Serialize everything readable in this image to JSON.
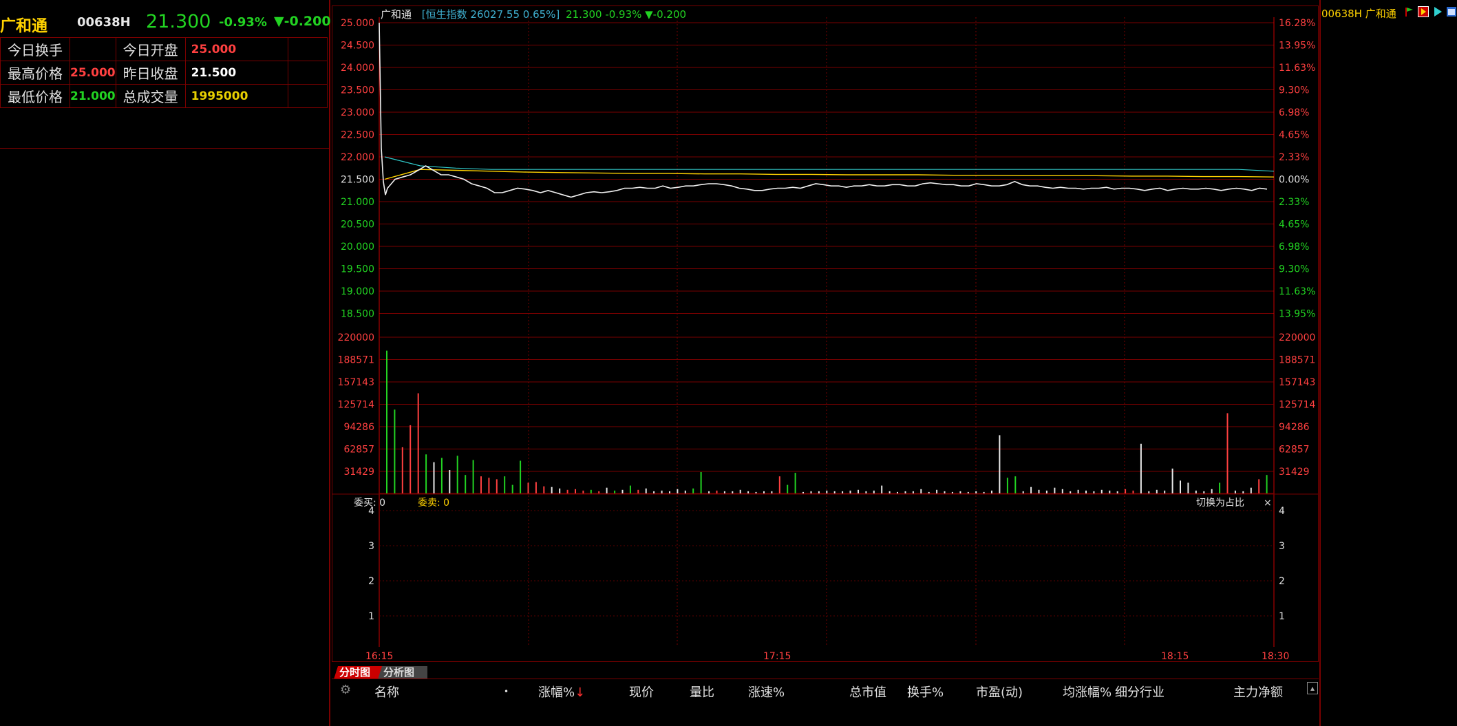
{
  "stock": {
    "name": "广和通",
    "code": "00638H",
    "price": "21.300",
    "change_pct": "-0.93%",
    "change": "▼-0.200",
    "rise_color": "#ff4040",
    "fall_color": "#22d322"
  },
  "info_table": {
    "row1": {
      "l1": "今日换手",
      "v1": "",
      "l2": "今日开盘",
      "v2": "25.000"
    },
    "row2": {
      "l1": "最高价格",
      "v1": "25.000",
      "l2": "昨日收盘",
      "v2": "21.500"
    },
    "row3": {
      "l1": "最低价格",
      "v1": "21.000",
      "l2": "总成交量",
      "v2": "1995000"
    }
  },
  "chart_header": {
    "name": "广和通",
    "index": "恒生指数 26027.55 0.65%",
    "price_info": "21.300 -0.93% ▼-0.200"
  },
  "chart_data": {
    "type": "line",
    "price_axis": {
      "left_ticks": [
        "25.000",
        "24.500",
        "24.000",
        "23.500",
        "23.000",
        "22.500",
        "22.000",
        "21.500",
        "21.000",
        "20.500",
        "20.000",
        "19.500",
        "19.000",
        "18.500"
      ],
      "right_ticks": [
        "16.28%",
        "13.95%",
        "11.63%",
        "9.30%",
        "6.98%",
        "4.65%",
        "2.33%",
        "0.00%",
        "2.33%",
        "4.65%",
        "6.98%",
        "9.30%",
        "11.63%",
        "13.95%"
      ],
      "ylim": [
        18.25,
        25.0
      ],
      "prev_close": 21.5
    },
    "volume_axis": {
      "ticks": [
        "220000",
        "188571",
        "157143",
        "125714",
        "94286",
        "62857",
        "31429"
      ],
      "ylim": [
        0,
        220000
      ]
    },
    "order_axis": {
      "ticks": [
        "4",
        "3",
        "2",
        "1"
      ]
    },
    "time_labels": [
      "16:15",
      "17:15",
      "18:15",
      "18:30"
    ],
    "series": [
      {
        "values": [
          25.0,
          22.2,
          21.45,
          21.15,
          21.3,
          21.5,
          21.55,
          21.6,
          21.7,
          21.8,
          21.7,
          21.6,
          21.6,
          21.55,
          21.5,
          21.4,
          21.35,
          21.3,
          21.2,
          21.2,
          21.25,
          21.3,
          21.28,
          21.25,
          21.2,
          21.25,
          21.2,
          21.15,
          21.1,
          21.15,
          21.2,
          21.22,
          21.2,
          21.22,
          21.25,
          21.3,
          21.3,
          21.32,
          21.3,
          21.3,
          21.35,
          21.3,
          21.32,
          21.35,
          21.35,
          21.38,
          21.4,
          21.4,
          21.38,
          21.35,
          21.3,
          21.28,
          21.25,
          21.25,
          21.28,
          21.3,
          21.3,
          21.32,
          21.3,
          21.35,
          21.4,
          21.38,
          21.35,
          21.35,
          21.32,
          21.35,
          21.35,
          21.38,
          21.35,
          21.35,
          21.38,
          21.38,
          21.35,
          21.35,
          21.4,
          21.42,
          21.4,
          21.38,
          21.38,
          21.35,
          21.35,
          21.4,
          21.38,
          21.35,
          21.35,
          21.38,
          21.45,
          21.38,
          21.35,
          21.35,
          21.32,
          21.3,
          21.32,
          21.3,
          21.3,
          21.28,
          21.3,
          21.3,
          21.32,
          21.28,
          21.3,
          21.3,
          21.28,
          21.25,
          21.28,
          21.3,
          21.25,
          21.28,
          21.3,
          21.28,
          21.28,
          21.3,
          21.28,
          21.25,
          21.28,
          21.3,
          21.28,
          21.25,
          21.3,
          21.28
        ]
      },
      {
        "values": [
          21.5,
          21.72,
          21.7,
          21.68,
          21.66,
          21.65,
          21.64,
          21.63,
          21.63,
          21.62,
          21.62,
          21.61,
          21.61,
          21.6,
          21.6,
          21.6,
          21.59,
          21.59,
          21.58,
          21.58,
          21.58,
          21.57,
          21.57,
          21.56,
          21.56,
          21.55
        ]
      },
      {
        "values": [
          22.0,
          21.8,
          21.75,
          21.72,
          21.72,
          21.72,
          21.72,
          21.72,
          21.72,
          21.72,
          21.72,
          21.72,
          21.72,
          21.72,
          21.72,
          21.72,
          21.72,
          21.72,
          21.72,
          21.72,
          21.72,
          21.72,
          21.72,
          21.72,
          21.72,
          21.68
        ]
      }
    ],
    "volume_bars": [
      {
        "v": 201000,
        "c": "g"
      },
      {
        "v": 118000,
        "c": "g"
      },
      {
        "v": 65000,
        "c": "r"
      },
      {
        "v": 96000,
        "c": "r"
      },
      {
        "v": 141000,
        "c": "r"
      },
      {
        "v": 55000,
        "c": "g"
      },
      {
        "v": 44000,
        "c": "w"
      },
      {
        "v": 50000,
        "c": "g"
      },
      {
        "v": 33000,
        "c": "w"
      },
      {
        "v": 53000,
        "c": "g"
      },
      {
        "v": 26000,
        "c": "g"
      },
      {
        "v": 47000,
        "c": "g"
      },
      {
        "v": 24000,
        "c": "r"
      },
      {
        "v": 22000,
        "c": "r"
      },
      {
        "v": 20000,
        "c": "r"
      },
      {
        "v": 24000,
        "c": "g"
      },
      {
        "v": 12000,
        "c": "g"
      },
      {
        "v": 46000,
        "c": "g"
      },
      {
        "v": 15000,
        "c": "r"
      },
      {
        "v": 16000,
        "c": "r"
      },
      {
        "v": 10000,
        "c": "r"
      },
      {
        "v": 9000,
        "c": "w"
      },
      {
        "v": 7000,
        "c": "w"
      },
      {
        "v": 5000,
        "c": "r"
      },
      {
        "v": 6000,
        "c": "r"
      },
      {
        "v": 4000,
        "c": "r"
      },
      {
        "v": 5000,
        "c": "g"
      },
      {
        "v": 3000,
        "c": "r"
      },
      {
        "v": 8000,
        "c": "w"
      },
      {
        "v": 4000,
        "c": "g"
      },
      {
        "v": 5000,
        "c": "w"
      },
      {
        "v": 11000,
        "c": "g"
      },
      {
        "v": 5000,
        "c": "r"
      },
      {
        "v": 7000,
        "c": "w"
      },
      {
        "v": 3000,
        "c": "w"
      },
      {
        "v": 4000,
        "c": "w"
      },
      {
        "v": 3000,
        "c": "w"
      },
      {
        "v": 6000,
        "c": "w"
      },
      {
        "v": 4000,
        "c": "w"
      },
      {
        "v": 7000,
        "c": "g"
      },
      {
        "v": 30000,
        "c": "g"
      },
      {
        "v": 3000,
        "c": "w"
      },
      {
        "v": 4000,
        "c": "r"
      },
      {
        "v": 3000,
        "c": "w"
      },
      {
        "v": 3000,
        "c": "w"
      },
      {
        "v": 5000,
        "c": "w"
      },
      {
        "v": 3000,
        "c": "w"
      },
      {
        "v": 2000,
        "c": "w"
      },
      {
        "v": 3000,
        "c": "w"
      },
      {
        "v": 3000,
        "c": "w"
      },
      {
        "v": 24000,
        "c": "r"
      },
      {
        "v": 12000,
        "c": "g"
      },
      {
        "v": 29000,
        "c": "g"
      },
      {
        "v": 2000,
        "c": "w"
      },
      {
        "v": 3000,
        "c": "w"
      },
      {
        "v": 3000,
        "c": "w"
      },
      {
        "v": 4000,
        "c": "w"
      },
      {
        "v": 3000,
        "c": "w"
      },
      {
        "v": 3000,
        "c": "w"
      },
      {
        "v": 4000,
        "c": "w"
      },
      {
        "v": 5000,
        "c": "w"
      },
      {
        "v": 3000,
        "c": "w"
      },
      {
        "v": 4000,
        "c": "w"
      },
      {
        "v": 11000,
        "c": "w"
      },
      {
        "v": 3000,
        "c": "w"
      },
      {
        "v": 2000,
        "c": "w"
      },
      {
        "v": 3000,
        "c": "w"
      },
      {
        "v": 3000,
        "c": "w"
      },
      {
        "v": 6000,
        "c": "w"
      },
      {
        "v": 2000,
        "c": "w"
      },
      {
        "v": 5000,
        "c": "w"
      },
      {
        "v": 3000,
        "c": "w"
      },
      {
        "v": 2000,
        "c": "w"
      },
      {
        "v": 3000,
        "c": "w"
      },
      {
        "v": 2000,
        "c": "w"
      },
      {
        "v": 3000,
        "c": "w"
      },
      {
        "v": 2000,
        "c": "w"
      },
      {
        "v": 4000,
        "c": "w"
      },
      {
        "v": 82000,
        "c": "w"
      },
      {
        "v": 22000,
        "c": "g"
      },
      {
        "v": 24000,
        "c": "g"
      },
      {
        "v": 3000,
        "c": "w"
      },
      {
        "v": 9000,
        "c": "w"
      },
      {
        "v": 5000,
        "c": "w"
      },
      {
        "v": 4000,
        "c": "w"
      },
      {
        "v": 8000,
        "c": "w"
      },
      {
        "v": 6000,
        "c": "w"
      },
      {
        "v": 3000,
        "c": "w"
      },
      {
        "v": 5000,
        "c": "w"
      },
      {
        "v": 4000,
        "c": "w"
      },
      {
        "v": 3000,
        "c": "w"
      },
      {
        "v": 5000,
        "c": "w"
      },
      {
        "v": 4000,
        "c": "w"
      },
      {
        "v": 3000,
        "c": "w"
      },
      {
        "v": 6000,
        "c": "r"
      },
      {
        "v": 4000,
        "c": "r"
      },
      {
        "v": 70000,
        "c": "w"
      },
      {
        "v": 3000,
        "c": "w"
      },
      {
        "v": 5000,
        "c": "w"
      },
      {
        "v": 4000,
        "c": "w"
      },
      {
        "v": 35000,
        "c": "w"
      },
      {
        "v": 18000,
        "c": "w"
      },
      {
        "v": 15000,
        "c": "w"
      },
      {
        "v": 4000,
        "c": "w"
      },
      {
        "v": 3000,
        "c": "w"
      },
      {
        "v": 6000,
        "c": "w"
      },
      {
        "v": 15000,
        "c": "g"
      },
      {
        "v": 113000,
        "c": "r"
      },
      {
        "v": 4000,
        "c": "w"
      },
      {
        "v": 3000,
        "c": "w"
      },
      {
        "v": 8000,
        "c": "w"
      },
      {
        "v": 20000,
        "c": "r"
      },
      {
        "v": 26000,
        "c": "g"
      }
    ]
  },
  "order_panel": {
    "buy": "委买: 0",
    "sell": "委卖: 0",
    "toggle": "切换为占比",
    "close": "×"
  },
  "tabs": {
    "fenshi": "分时图",
    "fenxi": "分析图"
  },
  "list_header": {
    "gear": "⚙",
    "name": "名称",
    "dot": "•",
    "change_pct": "涨幅%",
    "sort_arrow": "↓",
    "price": "现价",
    "vol_ratio": "量比",
    "speed": "涨速%",
    "market_cap": "总市值",
    "turnover": "换手%",
    "pe": "市盈(动)",
    "avg_change": "均涨幅%",
    "industry": "细分行业",
    "net_inflow": "主力净额",
    "collapse": "▴"
  },
  "right_panel": {
    "title": "00638H 广和通"
  }
}
